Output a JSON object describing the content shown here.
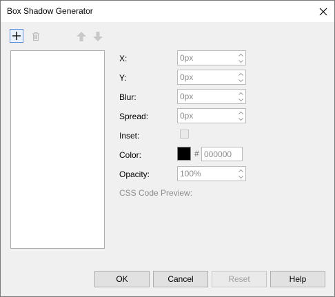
{
  "window": {
    "title": "Box Shadow Generator"
  },
  "toolbar": {
    "add": "add-icon",
    "delete": "trash-icon",
    "move_up": "arrow-up-icon",
    "move_down": "arrow-down-icon"
  },
  "fields": {
    "x": {
      "label": "X:",
      "value": "0px"
    },
    "y": {
      "label": "Y:",
      "value": "0px"
    },
    "blur": {
      "label": "Blur:",
      "value": "0px"
    },
    "spread": {
      "label": "Spread:",
      "value": "0px"
    },
    "inset": {
      "label": "Inset:"
    },
    "color": {
      "label": "Color:",
      "hash": "#",
      "hex": "000000",
      "swatch": "#000000"
    },
    "opacity": {
      "label": "Opacity:",
      "value": "100%"
    },
    "css_preview": {
      "label": "CSS Code Preview:"
    }
  },
  "buttons": {
    "ok": "OK",
    "cancel": "Cancel",
    "reset": "Reset",
    "help": "Help"
  },
  "colors": {
    "accent": "#5a8ed8",
    "disabled_text": "#8c8c8c"
  }
}
